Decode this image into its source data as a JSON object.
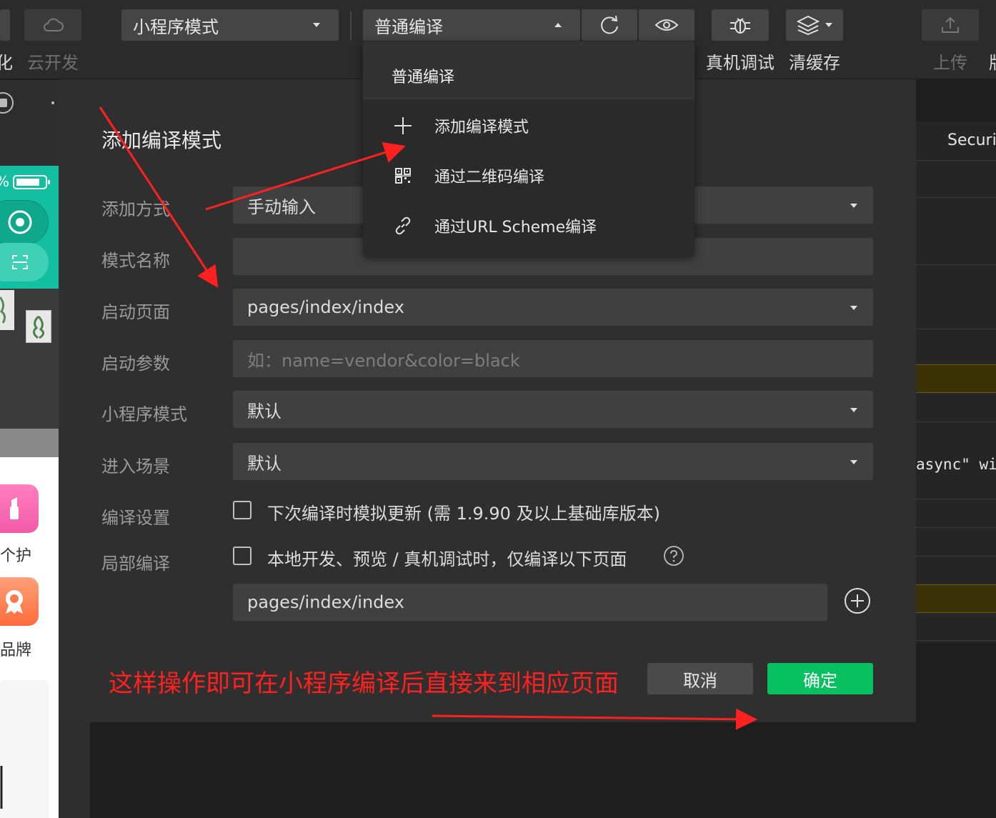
{
  "toolbar": {
    "left_cut_label": "化",
    "cloud_label": "云开发",
    "mode_select": "小程序模式",
    "compile_select": "普通编译",
    "debug_label": "真机调试",
    "cache_label": "清缓存",
    "upload_label": "上传",
    "right_cut_label": "版"
  },
  "simulator": {
    "percent": "%",
    "tile1": "个护",
    "tile2": "品牌"
  },
  "console": {
    "header": "Securit",
    "code": "async\" wi"
  },
  "modal": {
    "title": "添加编译模式",
    "fields": {
      "add_method_label": "添加方式",
      "add_method_value": "手动输入",
      "mode_name_label": "模式名称",
      "launch_page_label": "启动页面",
      "launch_page_value": "pages/index/index",
      "launch_params_label": "启动参数",
      "launch_params_placeholder": "如：name=vendor&color=black",
      "mini_mode_label": "小程序模式",
      "mini_mode_value": "默认",
      "scene_label": "进入场景",
      "scene_value": "默认",
      "compile_settings_label": "编译设置",
      "compile_settings_text": "下次编译时模拟更新 (需 1.9.90 及以上基础库版本)",
      "partial_label": "局部编译",
      "partial_text": "本地开发、预览 / 真机调试时，仅编译以下页面",
      "partial_page_value": "pages/index/index"
    },
    "annotation": "这样操作即可在小程序编译后直接来到相应页面",
    "cancel_label": "取消",
    "confirm_label": "确定"
  },
  "menu": {
    "header": "普通编译",
    "items": [
      {
        "label": "添加编译模式",
        "icon": "plus-icon"
      },
      {
        "label": "通过二维码编译",
        "icon": "qrcode-icon"
      },
      {
        "label": "通过URL Scheme编译",
        "icon": "link-icon"
      }
    ]
  },
  "colors": {
    "confirm_green": "#07c160",
    "annotation_red": "#ff2020",
    "teal": "#13bfa0"
  }
}
